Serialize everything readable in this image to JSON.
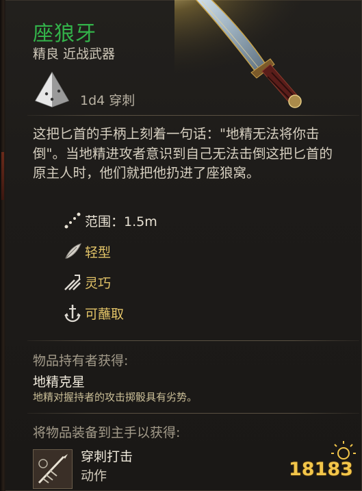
{
  "item": {
    "name": "座狼牙",
    "subtitle": "精良 近战武器",
    "damage": "1d4 穿刺",
    "description": "这把匕首的手柄上刻着一句话：\"地精无法将你击倒\"。当地精进攻者意识到自己无法击倒这把匕首的原主人时，他们就把他扔进了座狼窝。",
    "name_color": "#33b34a"
  },
  "properties": [
    {
      "icon": "range-icon",
      "label": "范围：1.5m",
      "color": "#e8e2d4"
    },
    {
      "icon": "feather-icon",
      "label": "轻型",
      "color": "#e3c468"
    },
    {
      "icon": "finesse-icon",
      "label": "灵巧",
      "color": "#e3c468"
    },
    {
      "icon": "dippable-icon",
      "label": "可蘸取",
      "color": "#e3c468"
    }
  ],
  "wielder_section": {
    "heading": "物品持有者获得:",
    "passive_name": "地精克星",
    "passive_desc": "地精对握持者的攻击掷骰具有劣势。"
  },
  "mainhand_section": {
    "heading": "将物品装备到主手以获得:",
    "action_name": "穿刺打击",
    "action_type": "动作",
    "action_icon": "piercing-strike-icon"
  },
  "watermark": {
    "text": "18183"
  }
}
